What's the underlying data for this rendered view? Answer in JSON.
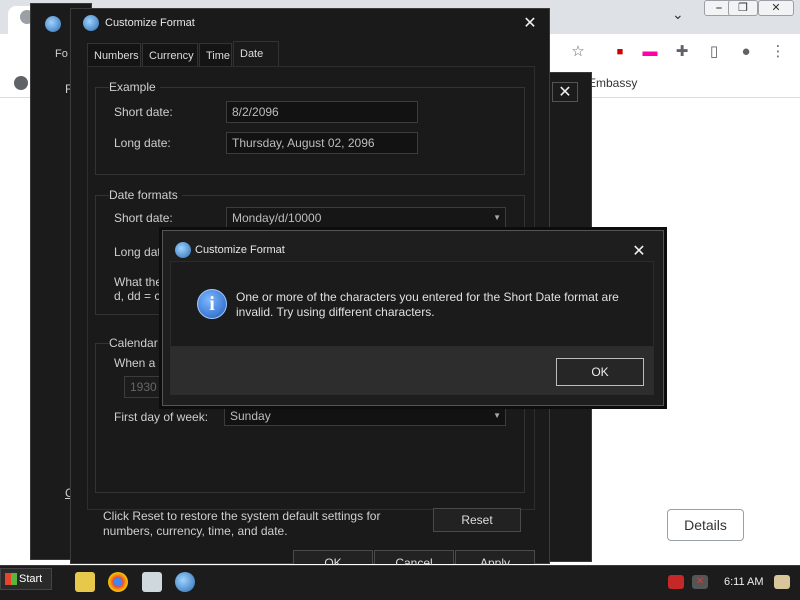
{
  "browser": {
    "bookmark_embassy": "Embassy",
    "details_button": "Details",
    "window_buttons": [
      "⎯",
      "❐",
      "✕"
    ]
  },
  "background_window": {
    "tab_label": "Fo",
    "side_letter": "F",
    "bottom_letter": "C"
  },
  "main_dialog": {
    "title": "Customize Format",
    "tabs": [
      "Numbers",
      "Currency",
      "Time",
      "Date"
    ],
    "active_tab": "Date",
    "example": {
      "group_label": "Example",
      "short_label": "Short date:",
      "short_value": "8/2/2096",
      "long_label": "Long date:",
      "long_value": "Thursday, August 02, 2096"
    },
    "date_formats": {
      "group_label": "Date formats",
      "short_label": "Short date:",
      "short_value": "Monday/d/10000",
      "long_label": "Long dat",
      "what_line1": "What the",
      "what_line2": "d, dd = c"
    },
    "calendar": {
      "group_label": "Calendar",
      "when_text": "When a t",
      "year_value": "1930",
      "first_day_label": "First day of week:",
      "first_day_value": "Sunday"
    },
    "reset_text_line1": "Click Reset to restore the system default settings for",
    "reset_text_line2": "numbers, currency, time, and date.",
    "reset_button": "Reset",
    "ok_button": "OK",
    "cancel_button": "Cancel",
    "apply_button": "Apply"
  },
  "error_dialog": {
    "title": "Customize Format",
    "message": "One or more of the characters you entered for the Short Date format are invalid. Try using different characters.",
    "ok_button": "OK"
  },
  "taskbar": {
    "start_label": "Start",
    "time": "6:11 AM"
  }
}
